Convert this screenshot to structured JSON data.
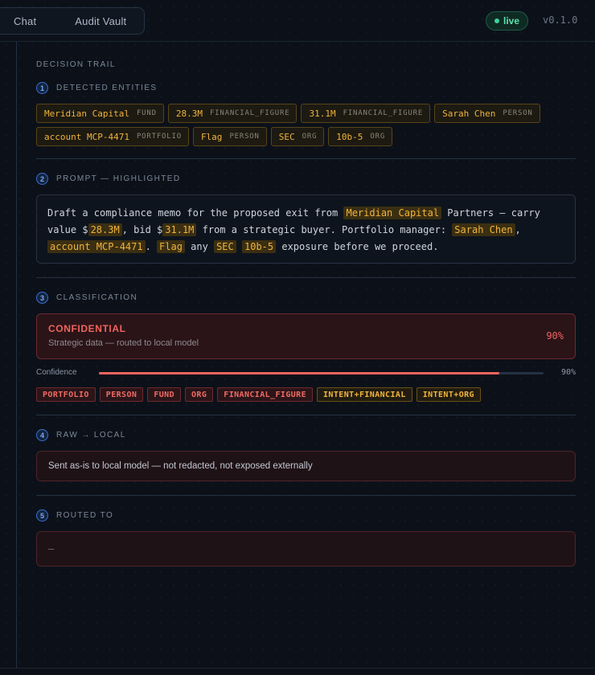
{
  "header": {
    "tabs": [
      {
        "label": "Chat"
      },
      {
        "label": "Audit Vault"
      }
    ],
    "status": "live",
    "version": "v0.1.0"
  },
  "trail": {
    "title": "DECISION TRAIL",
    "sections": [
      {
        "num": "1",
        "label": "DETECTED ENTITIES"
      },
      {
        "num": "2",
        "label": "PROMPT — HIGHLIGHTED"
      },
      {
        "num": "3",
        "label": "CLASSIFICATION"
      },
      {
        "num": "4",
        "label": "RAW → LOCAL"
      },
      {
        "num": "5",
        "label": "ROUTED TO"
      }
    ]
  },
  "entities": [
    {
      "value": "Meridian Capital",
      "type": "FUND"
    },
    {
      "value": "28.3M",
      "type": "FINANCIAL_FIGURE"
    },
    {
      "value": "31.1M",
      "type": "FINANCIAL_FIGURE"
    },
    {
      "value": "Sarah Chen",
      "type": "PERSON"
    },
    {
      "value": "account MCP-4471",
      "type": "PORTFOLIO"
    },
    {
      "value": "Flag",
      "type": "PERSON"
    },
    {
      "value": "SEC",
      "type": "ORG"
    },
    {
      "value": "10b-5",
      "type": "ORG"
    }
  ],
  "prompt": {
    "segments": [
      {
        "text": "Draft a compliance memo for the proposed exit from ",
        "hl": false
      },
      {
        "text": "Meridian Capital",
        "hl": true
      },
      {
        "text": " Partners — carry value $",
        "hl": false
      },
      {
        "text": "28.3M",
        "hl": true
      },
      {
        "text": ", bid $",
        "hl": false
      },
      {
        "text": "31.1M",
        "hl": true
      },
      {
        "text": " from a strategic buyer. Portfolio manager: ",
        "hl": false
      },
      {
        "text": "Sarah Chen",
        "hl": true
      },
      {
        "text": ", ",
        "hl": false
      },
      {
        "text": "account MCP-4471",
        "hl": true
      },
      {
        "text": ". ",
        "hl": false
      },
      {
        "text": "Flag",
        "hl": true
      },
      {
        "text": " any ",
        "hl": false
      },
      {
        "text": "SEC",
        "hl": true
      },
      {
        "text": " ",
        "hl": false
      },
      {
        "text": "10b-5",
        "hl": true
      },
      {
        "text": " exposure before we proceed.",
        "hl": false
      }
    ]
  },
  "classification": {
    "level": "CONFIDENTIAL",
    "description": "Strategic data — routed to local model",
    "score": "90%",
    "confidence_label": "Confidence",
    "confidence_value": "90%",
    "confidence_fraction": 0.9,
    "tags": [
      {
        "label": "PORTFOLIO",
        "tone": "red"
      },
      {
        "label": "PERSON",
        "tone": "red"
      },
      {
        "label": "FUND",
        "tone": "red"
      },
      {
        "label": "ORG",
        "tone": "red"
      },
      {
        "label": "FINANCIAL_FIGURE",
        "tone": "red"
      },
      {
        "label": "INTENT+FINANCIAL",
        "tone": "amber"
      },
      {
        "label": "INTENT+ORG",
        "tone": "amber"
      }
    ]
  },
  "raw_local": {
    "message": "Sent as-is to local model — not redacted, not exposed externally"
  },
  "routed_to": {
    "value": "—"
  }
}
